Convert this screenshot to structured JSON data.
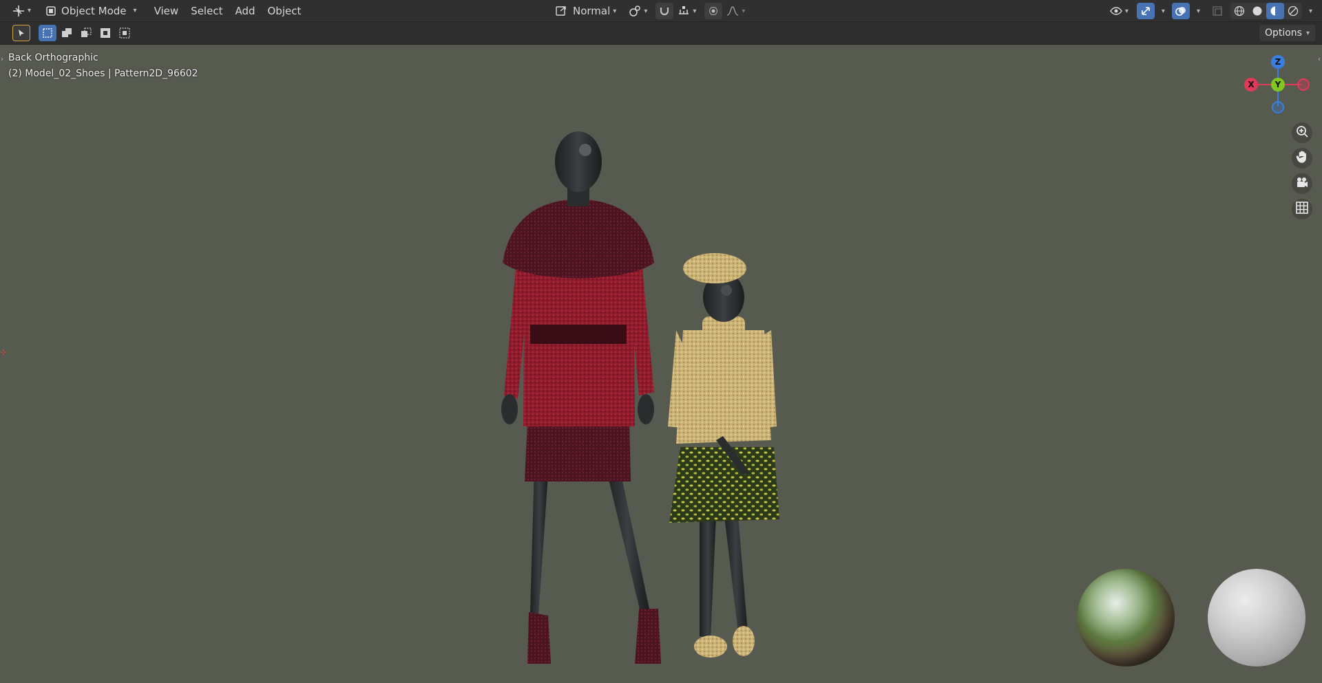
{
  "header": {
    "mode_label": "Object Mode",
    "menus": [
      "View",
      "Select",
      "Add",
      "Object"
    ],
    "orientation_label": "Normal"
  },
  "toolbar": {
    "options_label": "Options"
  },
  "viewport": {
    "view_name": "Back Orthographic",
    "object_info": "(2) Model_02_Shoes | Pattern2D_96602",
    "background_color": "#565a4f",
    "gizmo": {
      "z_label": "Z",
      "y_label": "Y",
      "x_label": "X",
      "x_color": "#e2395a",
      "y_color": "#82c71f",
      "z_color": "#3a7fe0"
    },
    "nav_icons": [
      "zoom-icon",
      "hand-pan-icon",
      "camera-icon",
      "grid-icon"
    ]
  },
  "colors": {
    "header_bg": "#303030",
    "accent": "#4772b3"
  }
}
